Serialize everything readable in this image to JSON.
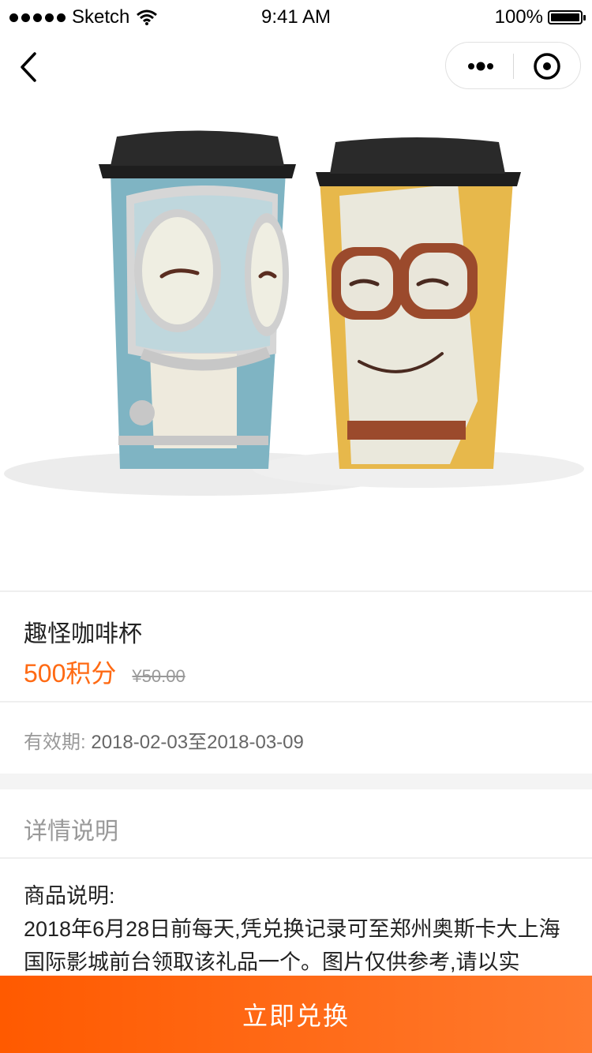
{
  "status_bar": {
    "carrier": "Sketch",
    "time": "9:41 AM",
    "battery": "100%"
  },
  "nav": {
    "back_icon": "chevron-left-icon",
    "more_icon": "more-dots-icon",
    "close_icon": "target-close-icon"
  },
  "product": {
    "name": "趣怪咖啡杯",
    "points": "500积分",
    "original_price": "¥50.00",
    "validity_label": "有效期:",
    "validity_value": "2018-02-03至2018-03-09"
  },
  "detail": {
    "heading": "详情说明",
    "desc_title": "商品说明:",
    "desc_body": "2018年6月28日前每天,凭兑换记录可至郑州奥斯卡大上海国际影城前台领取该礼品一个。图片仅供参考,请以实"
  },
  "cta": {
    "label": "立即兑换",
    "color": "#ff6a13"
  }
}
